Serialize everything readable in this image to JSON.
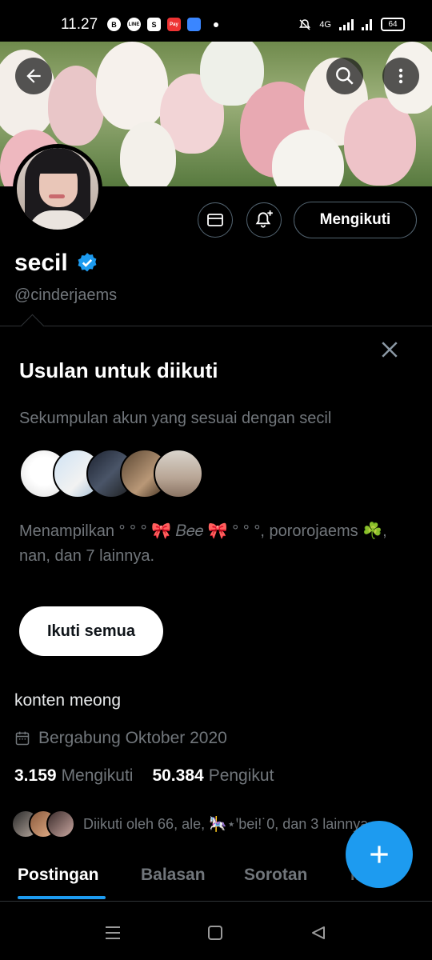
{
  "status_bar": {
    "time": "11.27",
    "app_icons": [
      "B",
      "LINE",
      "S",
      "Pay"
    ],
    "network": "4G",
    "battery": "64"
  },
  "profile": {
    "name": "secil",
    "handle": "@cinderjaems",
    "follow_button": "Mengikuti",
    "bio": "konten meong",
    "joined": "Bergabung Oktober 2020",
    "following_count": "3.159",
    "following_label": "Mengikuti",
    "followers_count": "50.384",
    "followers_label": "Pengikut",
    "followed_by": "Diikuti oleh 66, ale, 🎠⋆ꞌbei!˙0, dan 3 lainnya"
  },
  "suggestions": {
    "title": "Usulan untuk diikuti",
    "subtitle": "Sekumpulan akun yang sesuai dengan secil",
    "showing": "Menampilkan ° ° ° 🎀 𝐵𝑒𝑒 🎀 ° ° °, pororojaems ☘️, nan, dan 7 lainnya.",
    "follow_all": "Ikuti semua"
  },
  "tabs": [
    {
      "label": "Postingan"
    },
    {
      "label": "Balasan"
    },
    {
      "label": "Sorotan"
    },
    {
      "label": "Media"
    }
  ],
  "colors": {
    "accent": "#1d9bf0",
    "verified": "#1d9bf0",
    "muted_text": "#71767b",
    "background": "#000000"
  },
  "icons": [
    "back-arrow-icon",
    "search-icon",
    "more-vertical-icon",
    "mail-icon",
    "bell-plus-icon",
    "verified-badge-icon",
    "close-icon",
    "calendar-icon",
    "plus-icon",
    "menu-nav-icon",
    "home-nav-icon",
    "back-nav-icon"
  ]
}
